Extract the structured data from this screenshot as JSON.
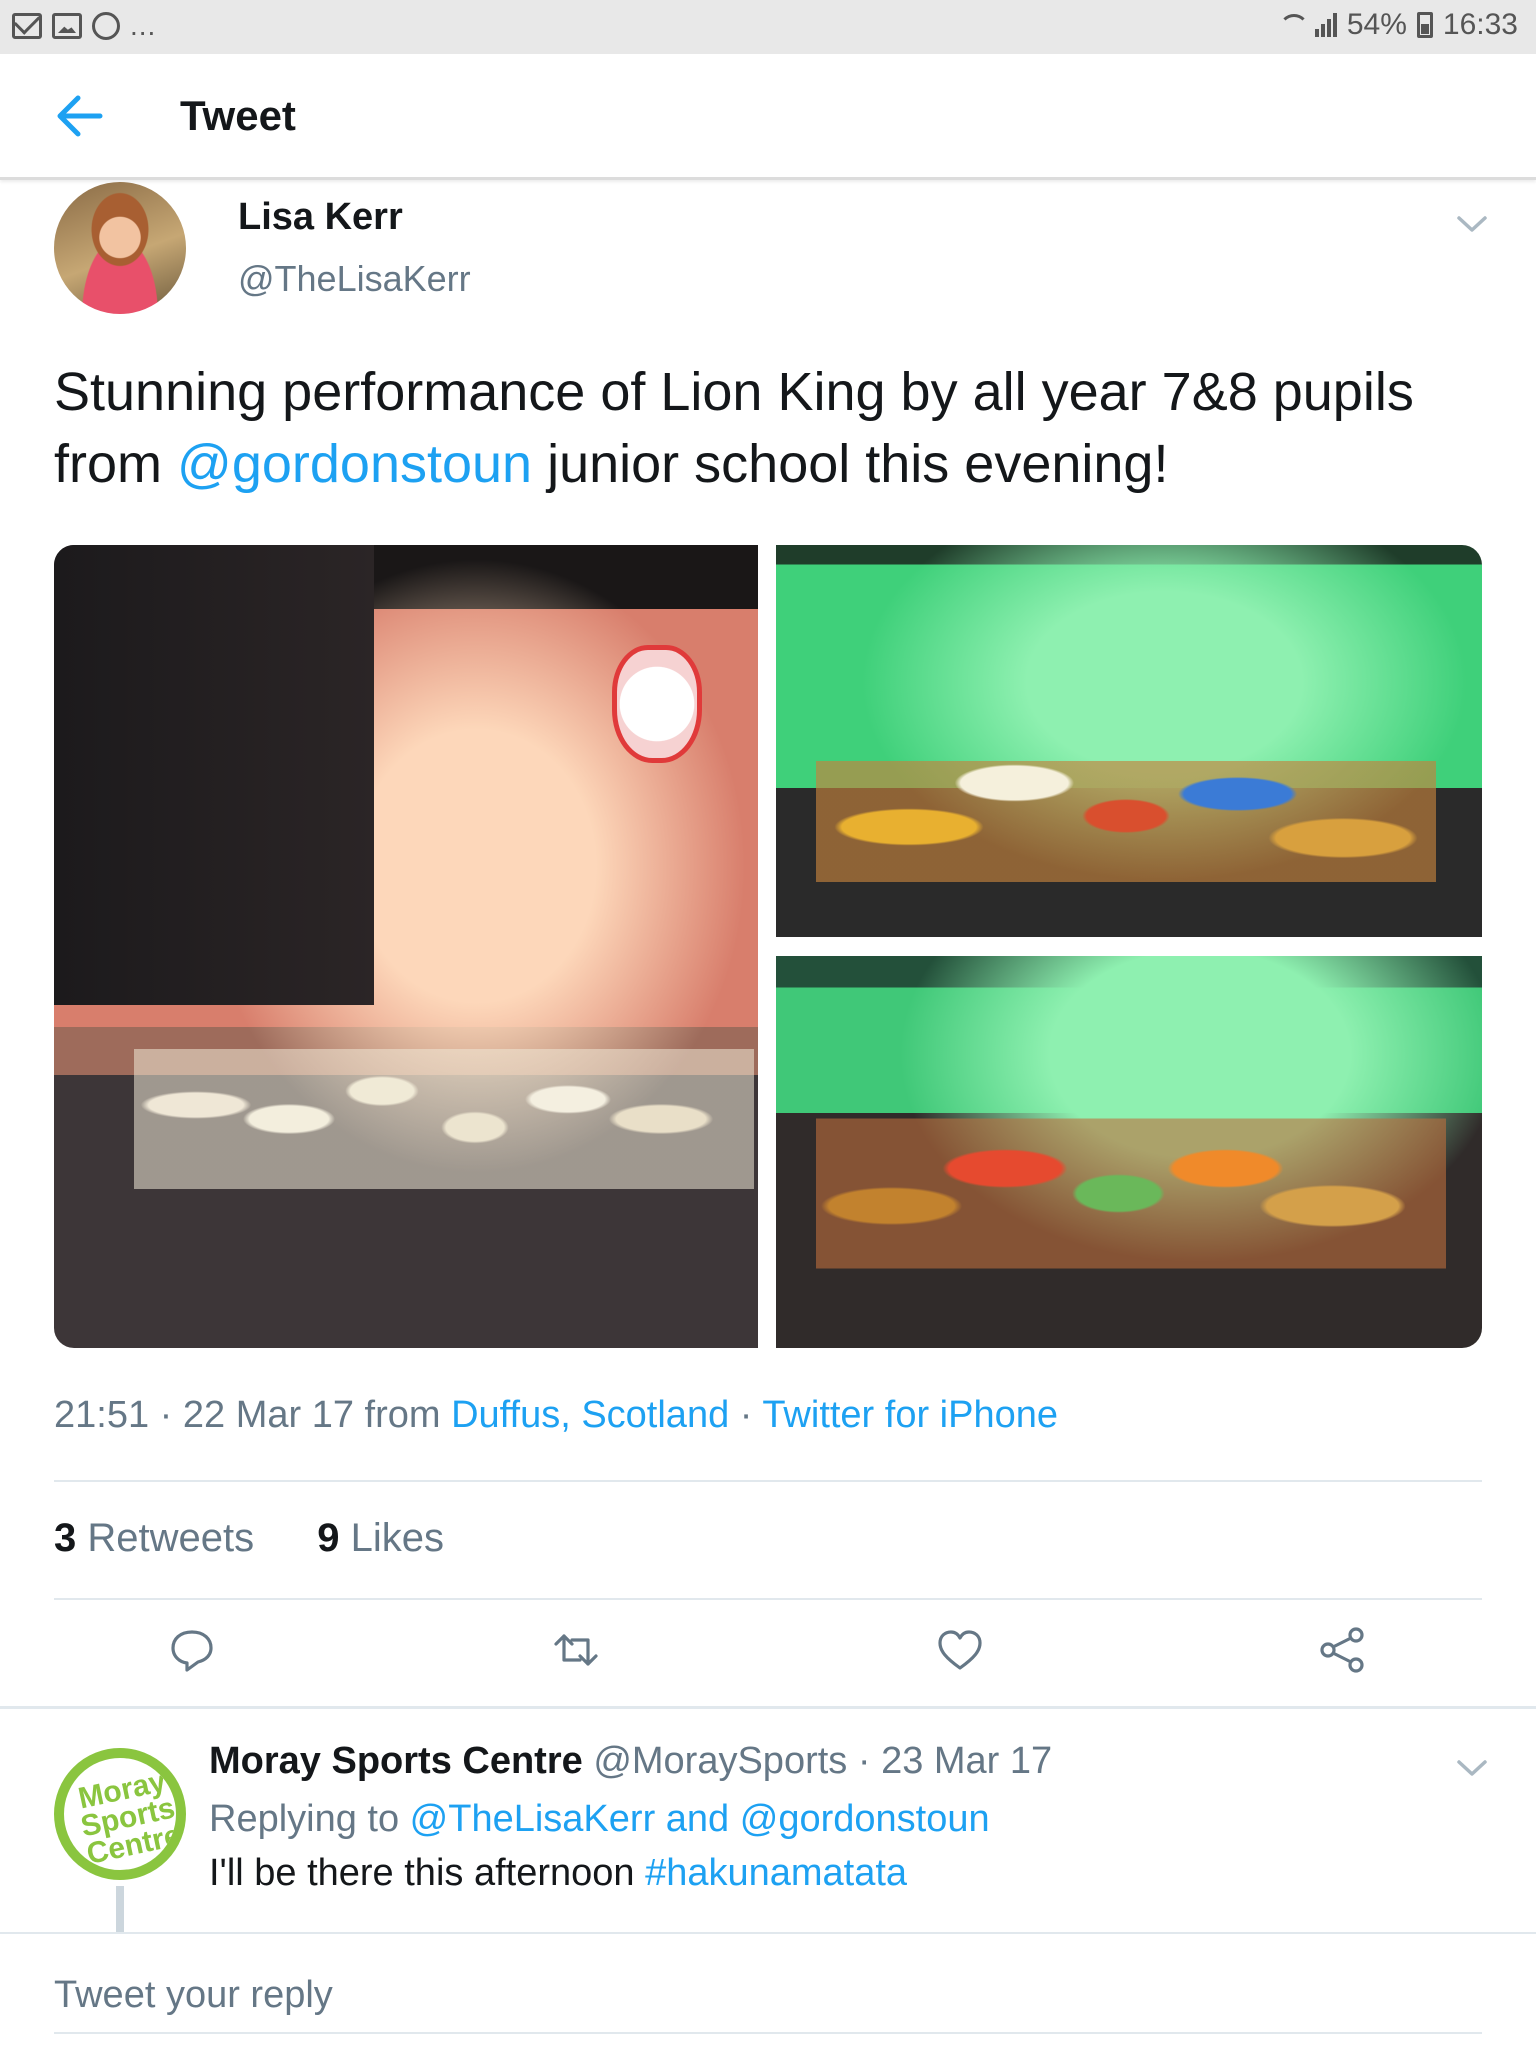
{
  "status_bar": {
    "battery": "54%",
    "time": "16:33",
    "left_icons": [
      "mail-icon",
      "gallery-icon",
      "bug-icon"
    ],
    "more": "..."
  },
  "header": {
    "title": "Tweet",
    "back_icon": "arrow-left-icon"
  },
  "tweet": {
    "author_name": "Lisa Kerr",
    "author_handle": "@TheLisaKerr",
    "text_part1": "Stunning performance of Lion King by all year 7&8 pupils from ",
    "mention": "@gordonstoun",
    "text_part2": " junior school this evening!",
    "time": "21:51",
    "date_sep": " · 22 Mar 17 from ",
    "location": "Duffus, Scotland",
    "client_sep": " · ",
    "client": "Twitter for iPhone",
    "retweets_count": "3",
    "retweets_label": "Retweets",
    "likes_count": "9",
    "likes_label": "Likes"
  },
  "actions": [
    "reply-icon",
    "retweet-icon",
    "like-icon",
    "share-icon"
  ],
  "reply": {
    "name": "Moray Sports Centre",
    "handle": "@MoraySports",
    "date": "· 23 Mar 17",
    "replying_prefix": "Replying to ",
    "replying_to_1": "@TheLisaKerr",
    "replying_and": " and ",
    "replying_to_2": "@gordonstoun",
    "text": "I'll be there this afternoon ",
    "hashtag": "#hakunamatata",
    "avatar_logo_line1": "Moray",
    "avatar_logo_line2": "Sports",
    "avatar_logo_line3": "Centre"
  },
  "compose": {
    "placeholder": "Tweet your reply"
  },
  "colors": {
    "link": "#1da1f2",
    "muted": "#657786",
    "text": "#14171a",
    "brand_green": "#8ac53f"
  }
}
